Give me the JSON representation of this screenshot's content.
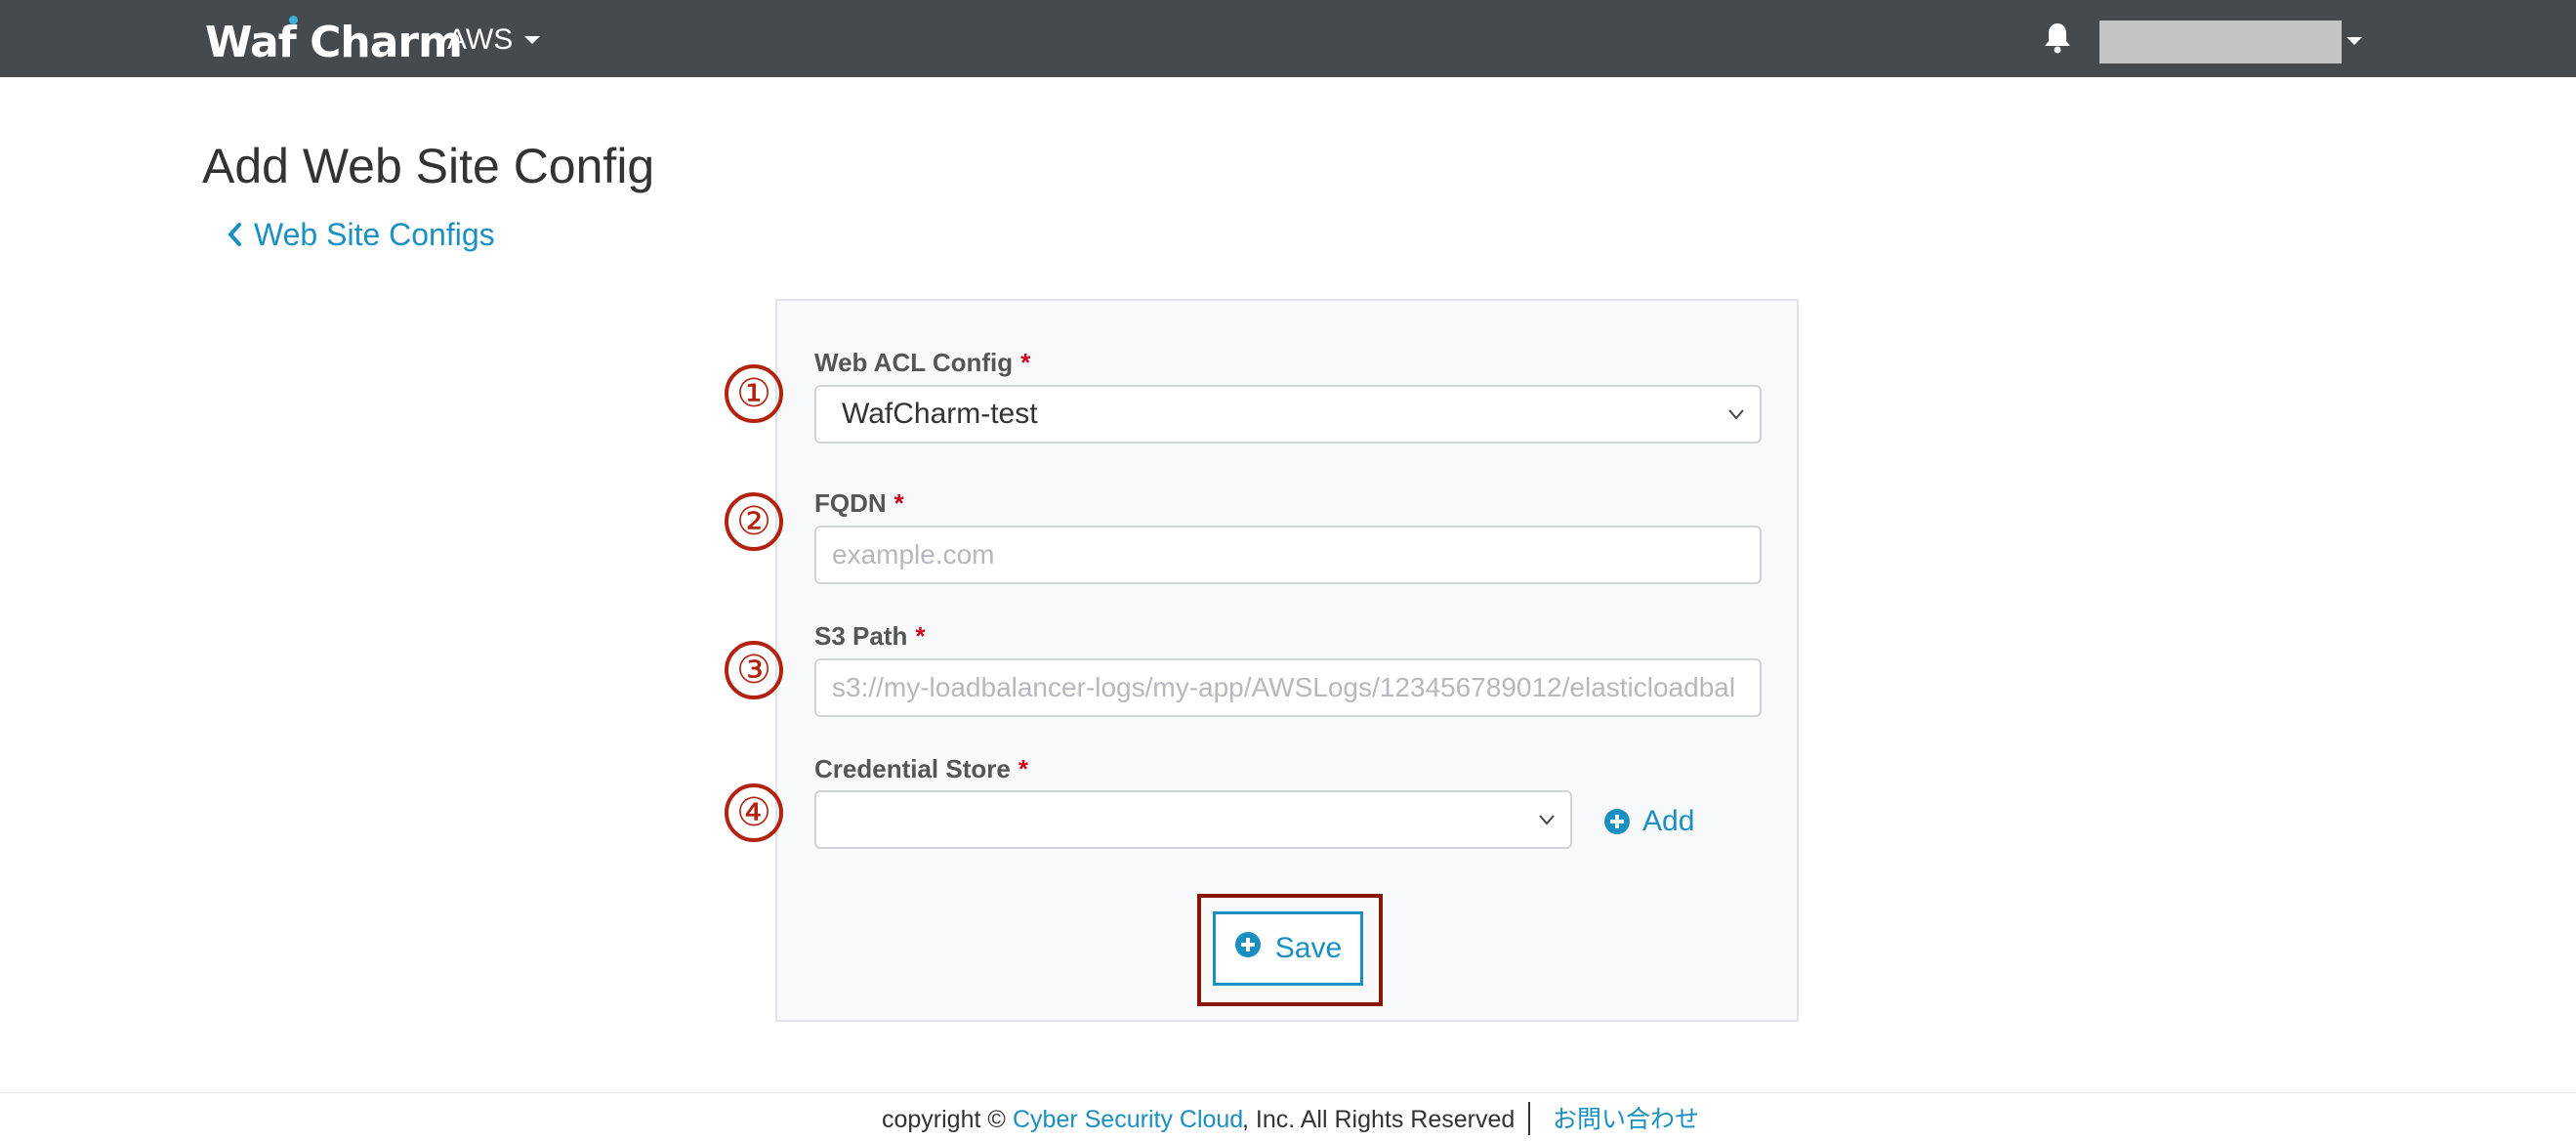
{
  "navbar": {
    "logo_text": "Waf Charm",
    "platform_label": "AWS",
    "icons": {
      "notifications": "bell-icon",
      "dropdown": "caret-down-icon"
    }
  },
  "page": {
    "title": "Add Web Site Config",
    "back_link_label": "Web Site Configs"
  },
  "form": {
    "fields": [
      {
        "step": "①",
        "label": "Web ACL Config",
        "required_mark": "*",
        "type": "select",
        "value": "WafCharm-test"
      },
      {
        "step": "②",
        "label": "FQDN",
        "required_mark": "*",
        "type": "text",
        "value": "",
        "placeholder": "example.com"
      },
      {
        "step": "③",
        "label": "S3 Path",
        "required_mark": "*",
        "type": "text",
        "value": "",
        "placeholder": "s3://my-loadbalancer-logs/my-app/AWSLogs/123456789012/elasticloadbal"
      },
      {
        "step": "④",
        "label": "Credential Store",
        "required_mark": "*",
        "type": "select",
        "value": ""
      }
    ],
    "add_label": "Add",
    "save_label": "Save"
  },
  "footer": {
    "copyright_prefix": "copyright ©",
    "company_link": "Cyber Security Cloud",
    "copyright_suffix": ", Inc. All Rights Reserved",
    "contact_link": "お問い合わせ"
  },
  "colors": {
    "navbar_bg": "#444a4d",
    "link_blue": "#1a8fc1",
    "annotation_red": "#b2220f",
    "required_red": "#d0021b"
  }
}
